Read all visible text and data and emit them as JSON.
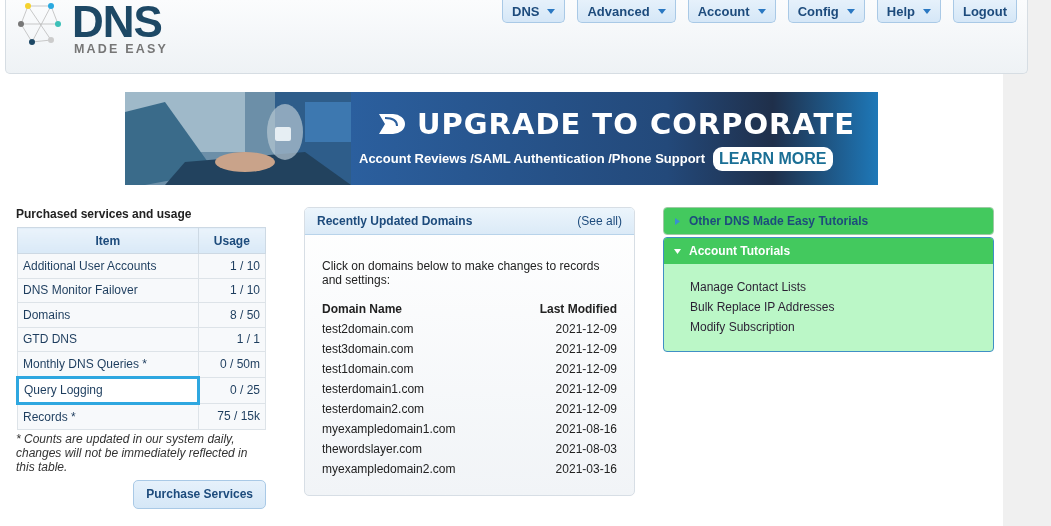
{
  "logo": {
    "name": "DNS",
    "tagline": "MADE EASY"
  },
  "nav": [
    {
      "label": "DNS",
      "dropdown": true
    },
    {
      "label": "Advanced",
      "dropdown": true
    },
    {
      "label": "Account",
      "dropdown": true
    },
    {
      "label": "Config",
      "dropdown": true
    },
    {
      "label": "Help",
      "dropdown": true
    },
    {
      "label": "Logout",
      "dropdown": false
    }
  ],
  "banner": {
    "kind": "picture",
    "headline": "UPGRADE TO CORPORATE",
    "subline": "Account Reviews /SAML Authentication /Phone Support",
    "button": "LEARN MORE"
  },
  "usage": {
    "title": "Purchased services and usage",
    "columns": [
      "Item",
      "Usage"
    ],
    "rows": [
      {
        "item": "Additional User Accounts",
        "usage": "1 / 10",
        "highlighted": false
      },
      {
        "item": "DNS Monitor Failover",
        "usage": "1 / 10",
        "highlighted": false
      },
      {
        "item": "Domains",
        "usage": "8 / 50",
        "highlighted": false
      },
      {
        "item": "GTD DNS",
        "usage": "1 / 1",
        "highlighted": false
      },
      {
        "item": "Monthly DNS Queries *",
        "usage": "0 / 50m",
        "highlighted": false
      },
      {
        "item": "Query Logging",
        "usage": "0 / 25",
        "highlighted": true
      },
      {
        "item": "Records *",
        "usage": "75 / 15k",
        "highlighted": false
      }
    ],
    "note": "* Counts are updated in our system daily, changes will not be immediately reflected in this table.",
    "button": "Purchase Services"
  },
  "recent": {
    "title": "Recently Updated Domains",
    "link": "(See all)",
    "intro": "Click on domains below to make changes to records and settings:",
    "columns": [
      "Domain Name",
      "Last Modified"
    ],
    "rows": [
      {
        "domain": "test2domain.com",
        "modified": "2021-12-09"
      },
      {
        "domain": "test3domain.com",
        "modified": "2021-12-09"
      },
      {
        "domain": "test1domain.com",
        "modified": "2021-12-09"
      },
      {
        "domain": "testerdomain1.com",
        "modified": "2021-12-09"
      },
      {
        "domain": "testerdomain2.com",
        "modified": "2021-12-09"
      },
      {
        "domain": "myexampledomain1.com",
        "modified": "2021-08-16"
      },
      {
        "domain": "thewordslayer.com",
        "modified": "2021-08-03"
      },
      {
        "domain": "myexampledomain2.com",
        "modified": "2021-03-16"
      }
    ]
  },
  "tutorials": [
    {
      "title": "Other DNS Made Easy Tutorials",
      "expanded": false
    },
    {
      "title": "Account Tutorials",
      "expanded": true,
      "items": [
        "Manage Contact Lists",
        "Bulk Replace IP Addresses",
        "Modify Subscription"
      ]
    }
  ]
}
